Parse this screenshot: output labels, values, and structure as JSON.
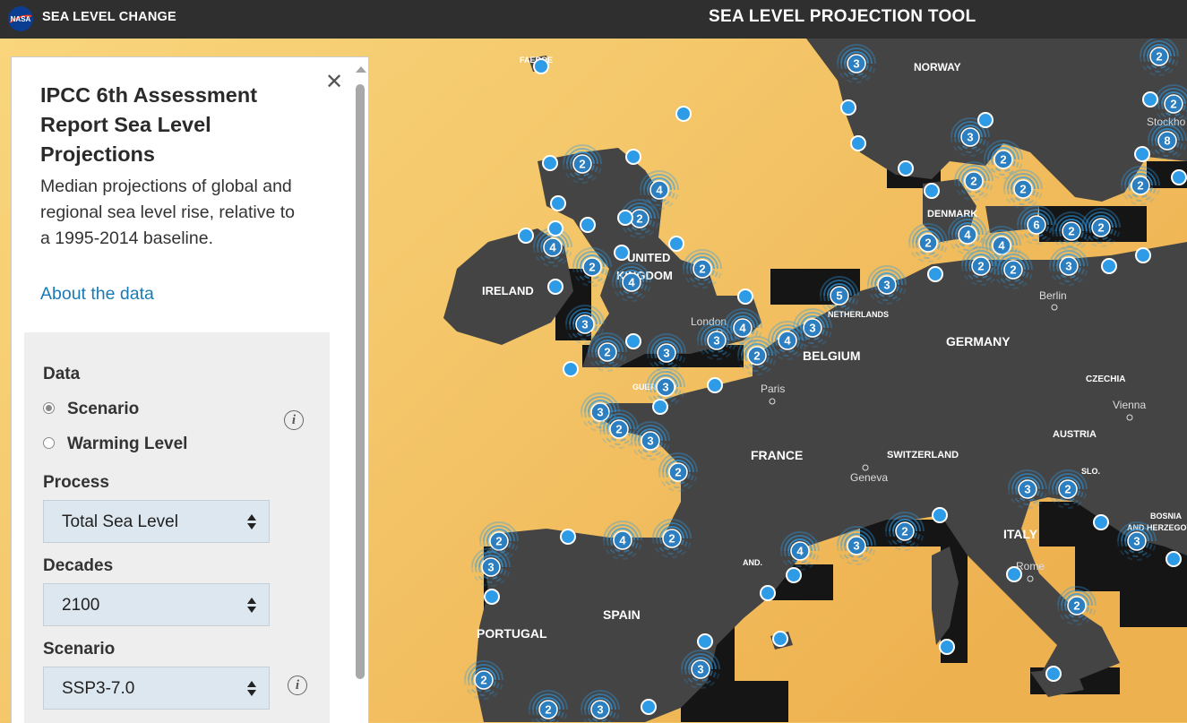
{
  "header": {
    "agency": "NASA",
    "site_title": "SEA LEVEL CHANGE",
    "tool_title": "SEA LEVEL PROJECTION TOOL"
  },
  "panel": {
    "title": "IPCC 6th Assessment Report Sea Level Projections",
    "description": "Median projections of global and regional sea level rise, relative to a 1995-2014 baseline.",
    "about_link": "About the data",
    "controls": {
      "data_label": "Data",
      "options": [
        {
          "label": "Scenario",
          "checked": true
        },
        {
          "label": "Warming Level",
          "checked": false
        }
      ],
      "process_label": "Process",
      "process_value": "Total Sea Level",
      "decades_label": "Decades",
      "decades_value": "2100",
      "scenario_label": "Scenario",
      "scenario_value": "SSP3-7.0"
    }
  },
  "map": {
    "colors": {
      "ocean_light": "#f7d478",
      "ocean_dark": "#efb352",
      "land": "#444444",
      "coast_dark": "#111111",
      "marker": "#2e9be6"
    },
    "countries": [
      "FAEROE",
      "NORWAY",
      "DENMARK",
      "IRELAND",
      "UNITED",
      "KINGDOM",
      "NETHERLANDS",
      "BELGIUM",
      "GERMANY",
      "CZECHIA",
      "AUSTRIA",
      "FRANCE",
      "SWITZERLAND",
      "SLO.",
      "BOSNIA",
      "AND HERZEGOV",
      "ITALY",
      "AND.",
      "SPAIN",
      "PORTUGAL",
      "GUERNSEY"
    ],
    "cities": [
      "London",
      "Paris",
      "Berlin",
      "Vienna",
      "Geneva",
      "Rome",
      "Stockho"
    ],
    "cluster_counts": [
      "3",
      "2",
      "2",
      "3",
      "8",
      "2",
      "2",
      "2",
      "2",
      "6",
      "2",
      "2",
      "4",
      "4",
      "2",
      "2",
      "3",
      "2",
      "2",
      "4",
      "2",
      "4",
      "2",
      "4",
      "2",
      "3",
      "5",
      "3",
      "4",
      "4",
      "3",
      "2",
      "3",
      "2",
      "3",
      "3",
      "3",
      "2",
      "3",
      "2",
      "3",
      "2",
      "2",
      "3",
      "4",
      "3",
      "2",
      "2",
      "3",
      "4",
      "2"
    ]
  }
}
